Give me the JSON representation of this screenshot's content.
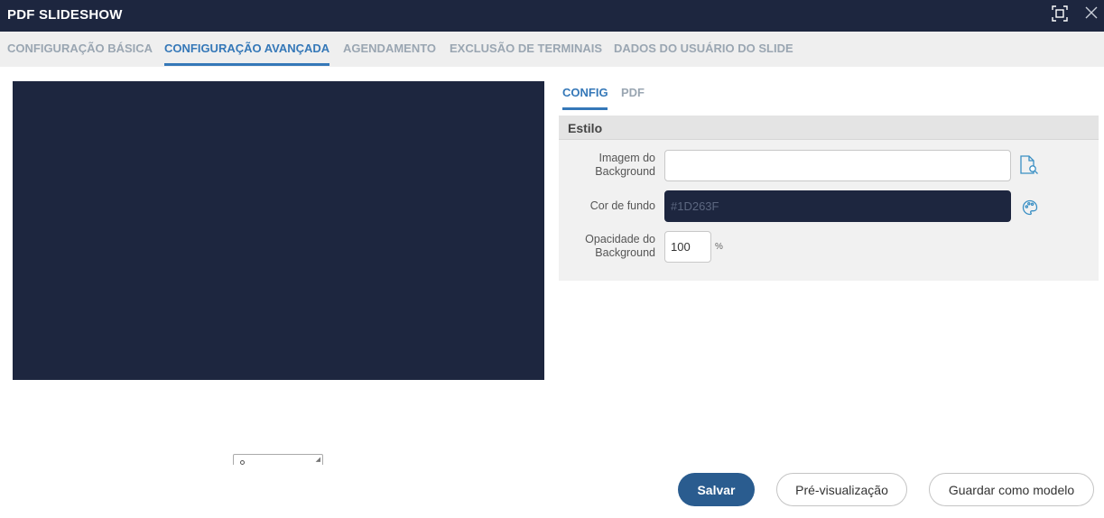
{
  "window": {
    "title": "PDF SLIDESHOW",
    "maximize_icon": "maximize-icon",
    "close_icon": "close-icon"
  },
  "tabs": [
    {
      "label": "CONFIGURAÇÃO BÁSICA",
      "active": false
    },
    {
      "label": "CONFIGURAÇÃO AVANÇADA",
      "active": true
    },
    {
      "label": "AGENDAMENTO",
      "active": false
    },
    {
      "label": "EXCLUSÃO DE TERMINAIS",
      "active": false
    },
    {
      "label": "DADOS DO USUÁRIO DO SLIDE",
      "active": false
    }
  ],
  "preview": {
    "background_color": "#1D263F"
  },
  "subtabs": [
    {
      "label": "CONFIG",
      "active": true
    },
    {
      "label": "PDF",
      "active": false
    }
  ],
  "section": {
    "title": "Estilo",
    "fields": {
      "background_image": {
        "label_line1": "Imagem do",
        "label_line2": "Background",
        "value": "",
        "icon": "file-search-icon"
      },
      "background_color": {
        "label": "Cor de fundo",
        "value": "#1D263F",
        "icon": "palette-icon"
      },
      "background_opacity": {
        "label_line1": "Opacidade do",
        "label_line2": "Background",
        "value": "100",
        "unit": "%"
      }
    }
  },
  "actions": {
    "save": "Salvar",
    "preview": "Pré-visualização",
    "save_template": "Guardar como modelo"
  },
  "colors": {
    "header": "#1D263F",
    "accent": "#3578B8",
    "primary_button": "#2A5C8F"
  }
}
